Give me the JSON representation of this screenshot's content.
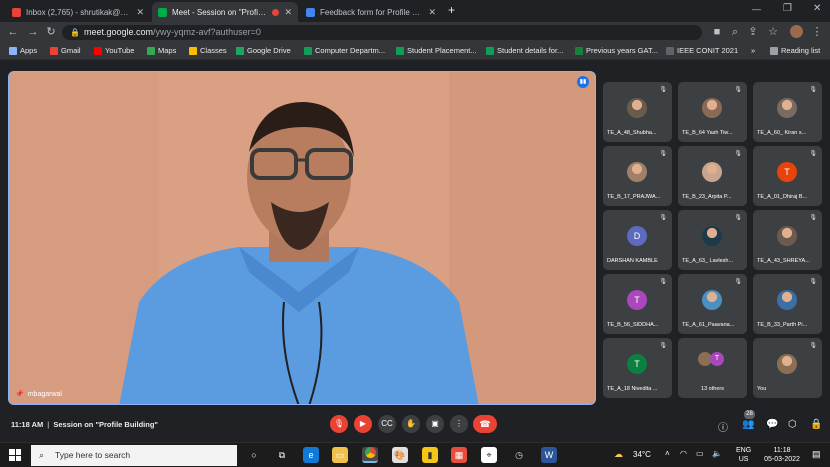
{
  "browser": {
    "tabs": [
      {
        "title": "Inbox (2,765) - shrutikak@mes.a",
        "icon": "gmail-icon",
        "color": "#ea4335"
      },
      {
        "title": "Meet - Session on \"Profile Bu",
        "icon": "meet-icon",
        "color": "#00ac47"
      },
      {
        "title": "Feedback form for Profile buildin",
        "icon": "forms-icon",
        "color": "#4285f4"
      }
    ],
    "new_tab": "+",
    "url_host": "meet.google.com",
    "url_path": "/ywy-yqmz-avf?authuser=0",
    "bookmarks": [
      {
        "label": "Apps",
        "color": "#8ab4f8"
      },
      {
        "label": "Gmail",
        "color": "#ea4335"
      },
      {
        "label": "YouTube",
        "color": "#ff0000"
      },
      {
        "label": "Maps",
        "color": "#34a853"
      },
      {
        "label": "Classes",
        "color": "#fbbc04"
      },
      {
        "label": "Google Drive",
        "color": "#1fa463"
      },
      {
        "label": "Computer Departm...",
        "color": "#0f9d58"
      },
      {
        "label": "Student Placement...",
        "color": "#0f9d58"
      },
      {
        "label": "Student details for...",
        "color": "#0f9d58"
      },
      {
        "label": "Previous years GAT...",
        "color": "#188038"
      },
      {
        "label": "IEEE CONIT 2021",
        "color": "#5f6368"
      }
    ],
    "reading_list": "Reading list",
    "more": "»"
  },
  "meet": {
    "presenter_name": "mbagarwal",
    "participants": [
      {
        "name": "TE_A_48_Shubha...",
        "type": "photo",
        "color": "#6b5b4b"
      },
      {
        "name": "TE_B_64 Yash Tiw...",
        "type": "photo",
        "color": "#8a6a55"
      },
      {
        "name": "TE_A_60_ Kiran s...",
        "type": "photo",
        "color": "#7b6a5f"
      },
      {
        "name": "TE_B_17_PRAJWA...",
        "type": "photo",
        "color": "#a0806a"
      },
      {
        "name": "TE_B_23_Arpita P...",
        "type": "photo",
        "color": "#c7a58f"
      },
      {
        "name": "TE_A_01_Dhiraj B...",
        "type": "letter",
        "letter": "T",
        "color": "#e8430a"
      },
      {
        "name": "DARSHAN KAMBLE",
        "type": "letter",
        "letter": "D",
        "color": "#5c6bc0"
      },
      {
        "name": "TE_A_63_ Lavlesh...",
        "type": "photo",
        "color": "#1e3a4a"
      },
      {
        "name": "TE_A_43_SHREYA...",
        "type": "photo",
        "color": "#6d5a4e"
      },
      {
        "name": "TE_B_56_SIDDHA...",
        "type": "letter",
        "letter": "T",
        "color": "#ab47bc"
      },
      {
        "name": "TE_A_61_Paavana...",
        "type": "photo",
        "color": "#4a90c0"
      },
      {
        "name": "TE_B_33_Parth Pi...",
        "type": "photo",
        "color": "#3a6fa8"
      },
      {
        "name": "TE_A_18 Nivedita ...",
        "type": "letter",
        "letter": "T",
        "color": "#0b8043"
      },
      {
        "name": "13 others",
        "type": "others",
        "color": "#ab47bc"
      },
      {
        "name": "You",
        "type": "photo",
        "color": "#8b6f52"
      }
    ],
    "time": "11:18 AM",
    "separator": "|",
    "meeting_title": "Session on \"Profile Building\"",
    "participant_count": "28"
  },
  "taskbar": {
    "search_placeholder": "Type here to search",
    "weather": "34°C",
    "lang_line1": "ENG",
    "lang_line2": "US",
    "clock_time": "11:18",
    "clock_date": "05-03-2022"
  },
  "colors": {
    "end_call": "#ea4335",
    "muted": "#ea4335",
    "accent": "#8ab4f8"
  }
}
